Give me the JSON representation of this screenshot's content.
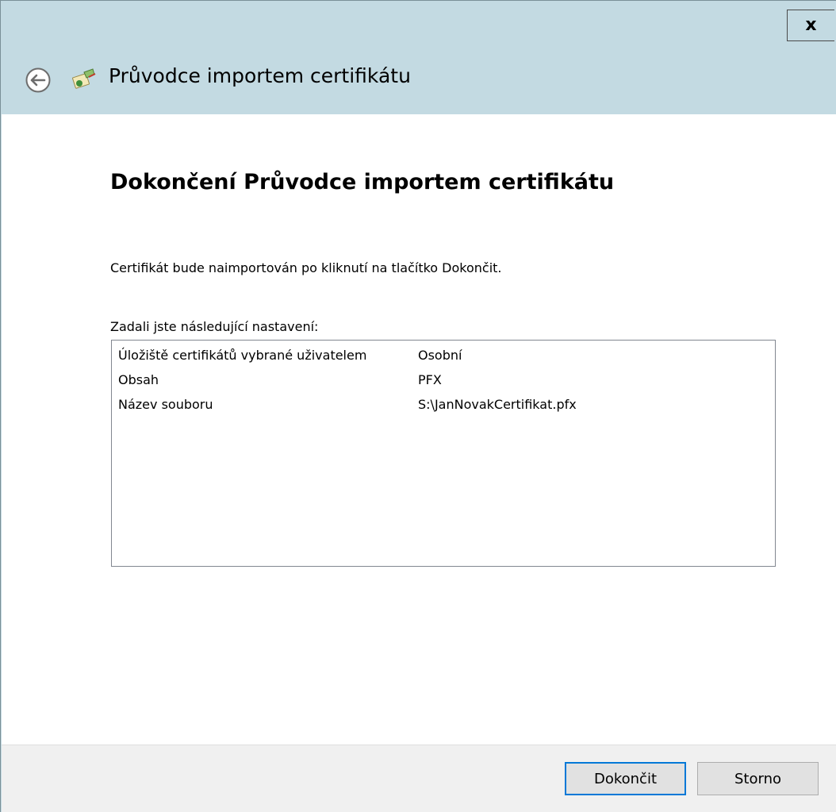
{
  "titlebar": {
    "close_label": "x"
  },
  "header": {
    "title": "Průvodce importem certifikátu",
    "back_icon": "back-arrow-icon",
    "wizard_icon": "certificate-wizard-icon"
  },
  "main": {
    "heading": "Dokončení Průvodce importem certifikátu",
    "info": "Certifikát bude naimportován po kliknutí na tlačítko Dokončit.",
    "settings_label": "Zadali jste následující nastavení:",
    "settings": [
      {
        "key": "Úložiště certifikátů vybrané uživatelem",
        "value": "Osobní"
      },
      {
        "key": "Obsah",
        "value": "PFX"
      },
      {
        "key": "Název souboru",
        "value": "S:\\JanNovakCertifikat.pfx"
      }
    ]
  },
  "footer": {
    "finish_label": "Dokončit",
    "cancel_label": "Storno"
  },
  "colors": {
    "titlebar_bg": "#c3dae2",
    "content_bg": "#ffffff",
    "footer_bg": "#f0f0f0",
    "default_button_border": "#0078d7"
  }
}
